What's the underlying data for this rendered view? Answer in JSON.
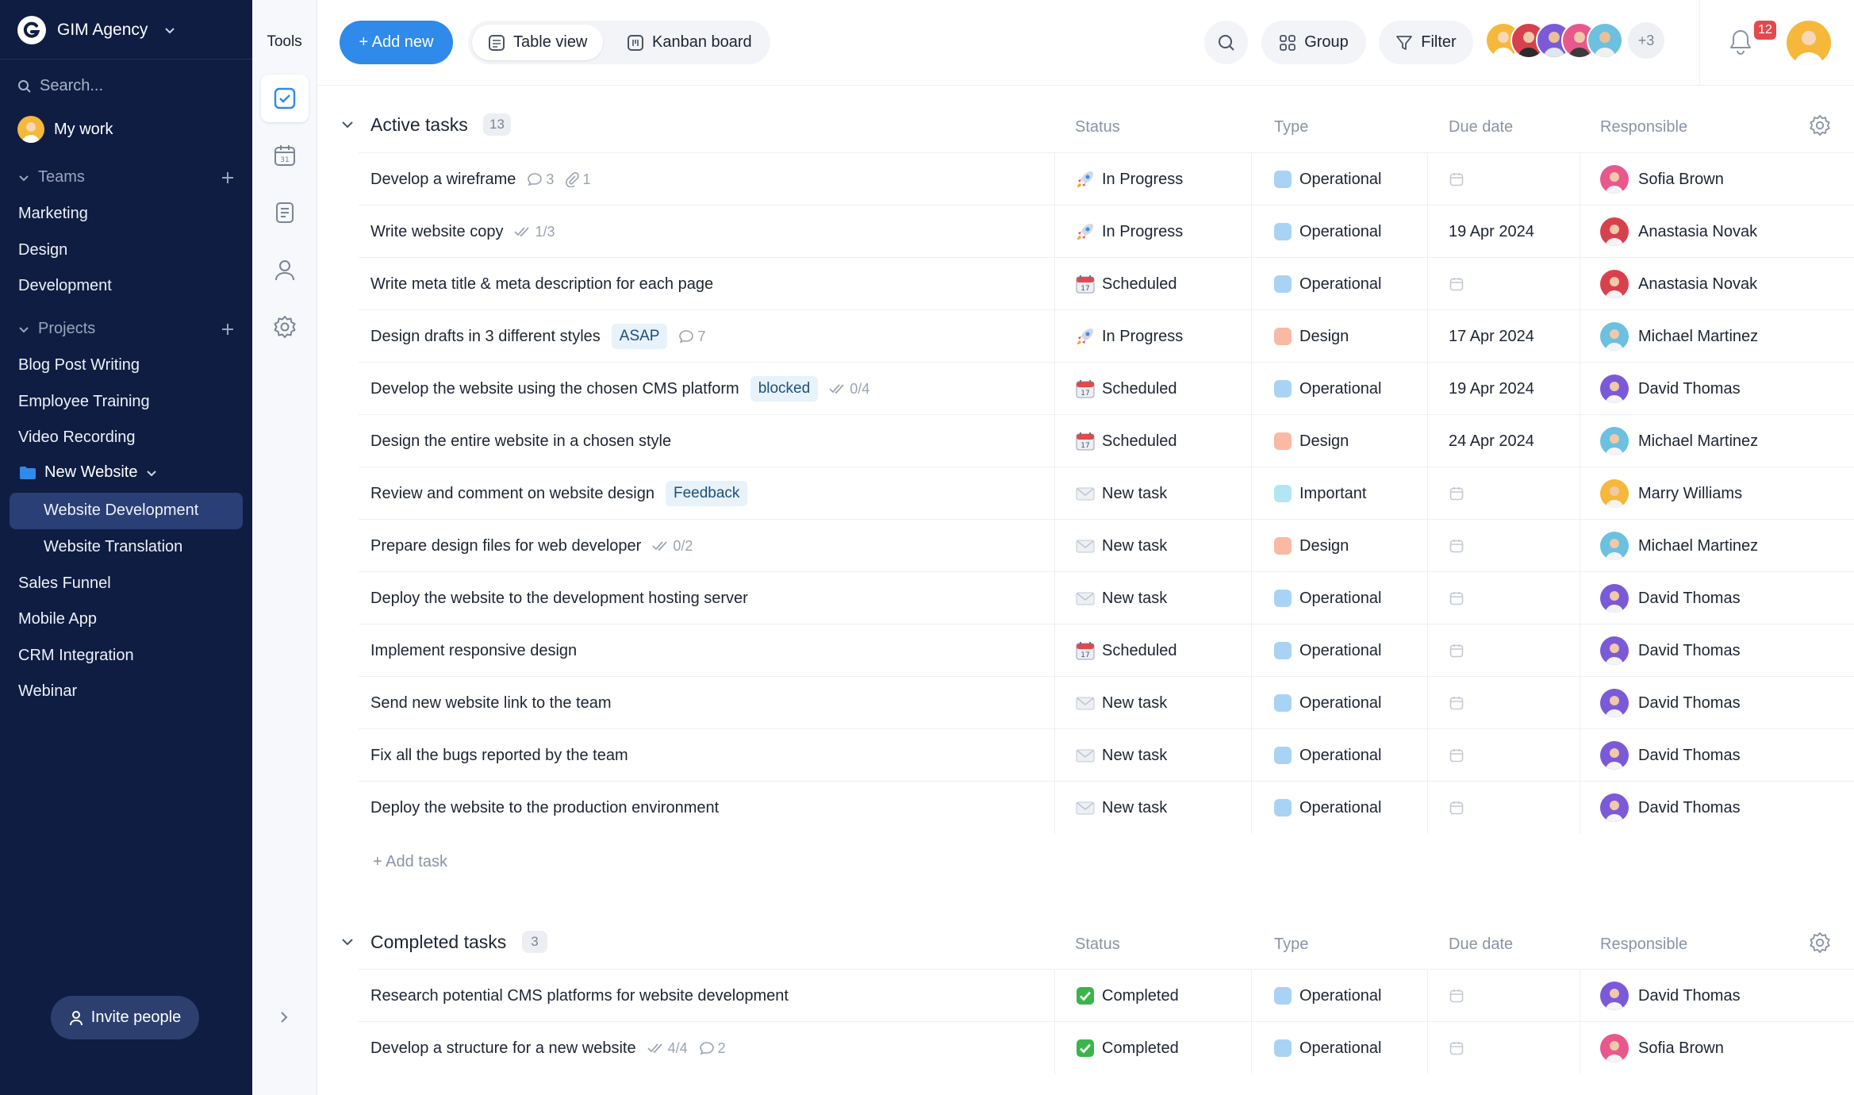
{
  "sidebar": {
    "workspace": "GIM Agency",
    "search_placeholder": "Search...",
    "my_work": "My work",
    "teams_label": "Teams",
    "teams": [
      "Marketing",
      "Design",
      "Development"
    ],
    "projects_label": "Projects",
    "projects_top": [
      "Blog Post Writing",
      "Employee Training",
      "Video Recording"
    ],
    "folder": "New Website",
    "folder_children": [
      "Website Development",
      "Website Translation"
    ],
    "projects_bottom": [
      "Sales Funnel",
      "Mobile App",
      "CRM Integration",
      "Webinar"
    ],
    "invite": "Invite people"
  },
  "tools": {
    "title": "Tools"
  },
  "topbar": {
    "add_new": "+ Add new",
    "table_view": "Table view",
    "kanban": "Kanban board",
    "group": "Group",
    "filter": "Filter",
    "more_members": "+3",
    "notifications": "12"
  },
  "columns": {
    "status": "Status",
    "type": "Type",
    "due": "Due date",
    "responsible": "Responsible"
  },
  "active": {
    "title": "Active tasks",
    "count": "13",
    "add_task": "+ Add task",
    "rows": [
      {
        "name": "Develop a wireframe",
        "comments": "3",
        "attachments": "1",
        "status": "In Progress",
        "type": "Operational",
        "due": "",
        "resp": "Sofia Brown"
      },
      {
        "name": "Write website copy",
        "checks": "1/3",
        "status": "In Progress",
        "type": "Operational",
        "due": "19 Apr 2024",
        "resp": "Anastasia Novak"
      },
      {
        "name": "Write meta title & meta description for each page",
        "status": "Scheduled",
        "type": "Operational",
        "due": "",
        "resp": "Anastasia Novak"
      },
      {
        "name": "Design drafts in 3 different styles",
        "tag": "ASAP",
        "comments": "7",
        "status": "In Progress",
        "type": "Design",
        "due": "17 Apr 2024",
        "resp": "Michael Martinez"
      },
      {
        "name": "Develop the website using the chosen CMS platform",
        "tag": "blocked",
        "checks": "0/4",
        "status": "Scheduled",
        "type": "Operational",
        "due": "19 Apr 2024",
        "resp": "David Thomas"
      },
      {
        "name": "Design the entire website in a chosen style",
        "status": "Scheduled",
        "type": "Design",
        "due": "24 Apr 2024",
        "resp": "Michael Martinez"
      },
      {
        "name": "Review and comment on website design",
        "tag": "Feedback",
        "status": "New task",
        "type": "Important",
        "due": "",
        "resp": "Marry Williams"
      },
      {
        "name": "Prepare design files for web developer",
        "checks": "0/2",
        "status": "New task",
        "type": "Design",
        "due": "",
        "resp": "Michael Martinez"
      },
      {
        "name": "Deploy the website to the development hosting server",
        "status": "New task",
        "type": "Operational",
        "due": "",
        "resp": "David Thomas"
      },
      {
        "name": "Implement responsive design",
        "status": "Scheduled",
        "type": "Operational",
        "due": "",
        "resp": "David Thomas"
      },
      {
        "name": "Send new website link to the team",
        "status": "New task",
        "type": "Operational",
        "due": "",
        "resp": "David Thomas"
      },
      {
        "name": "Fix all the bugs reported by the team",
        "status": "New task",
        "type": "Operational",
        "due": "",
        "resp": "David Thomas"
      },
      {
        "name": "Deploy the website to the production environment",
        "status": "New task",
        "type": "Operational",
        "due": "",
        "resp": "David Thomas"
      }
    ]
  },
  "completed": {
    "title": "Completed tasks",
    "count": "3",
    "rows": [
      {
        "name": "Research potential CMS platforms for website development",
        "status": "Completed",
        "type": "Operational",
        "due": "",
        "resp": "David Thomas"
      },
      {
        "name": "Develop a structure for a new website",
        "checks": "4/4",
        "comments": "2",
        "status": "Completed",
        "type": "Operational",
        "due": "",
        "resp": "Sofia Brown"
      }
    ]
  },
  "colors": {
    "sidebar_bg": "#0f1d42",
    "accent": "#2f8ae9",
    "type_operational": "#a9d3f5",
    "type_design": "#f9b9a3",
    "type_important": "#b3e6f5"
  },
  "people": {
    "Sofia Brown": "#e8588c",
    "Anastasia Novak": "#d9404d",
    "Michael Martinez": "#6cc0e0",
    "David Thomas": "#7b5ad8",
    "Marry Williams": "#f5b83a"
  }
}
